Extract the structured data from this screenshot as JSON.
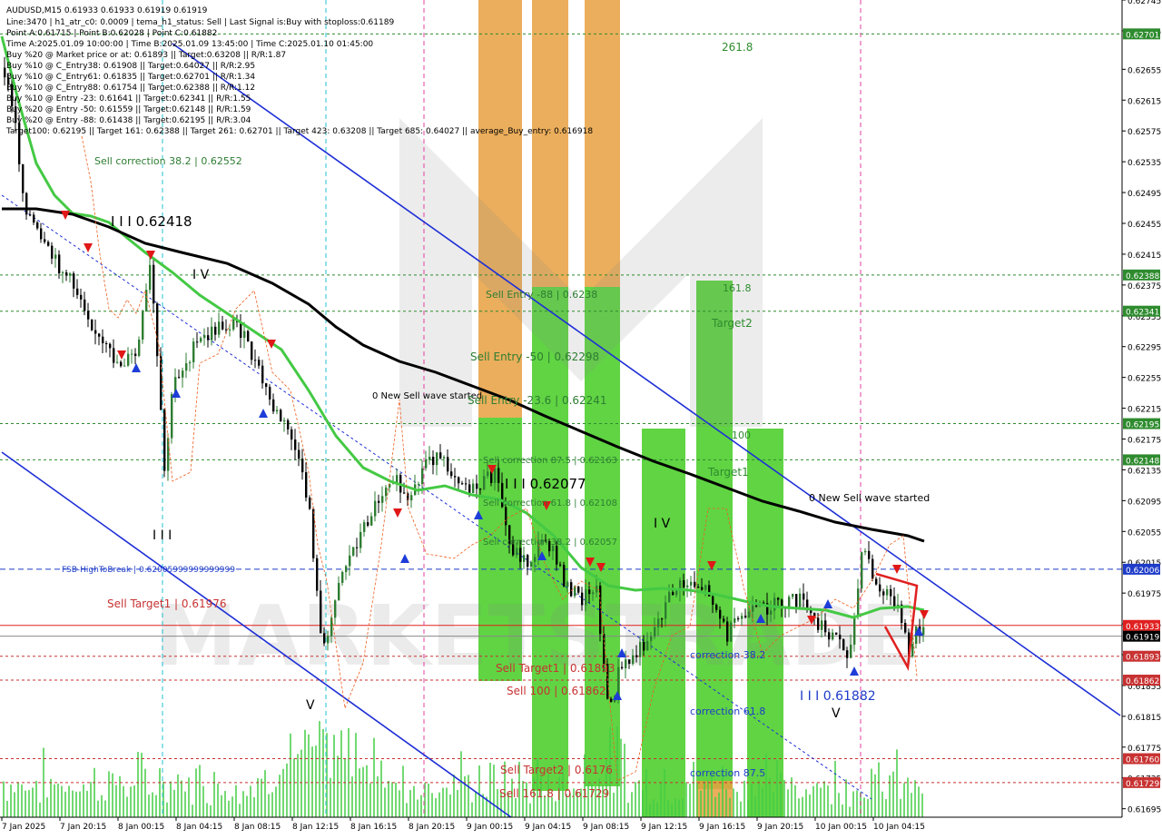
{
  "header": {
    "symbol_line": "AUDUSD,M15  0.61933 0.61933 0.61919 0.61919",
    "info_lines": [
      "Line:3470  |  h1_atr_c0: 0.0009  |  tema_h1_status: Sell  |  Last Signal is:Buy with stoploss:0.61189",
      "Point A:0.61715  |  Point B:0.62028  |  Point C:0.61882",
      "Time A:2025.01.09 10:00:00  |  Time B:2025.01.09 13:45:00  |  Time C:2025.01.10 01:45:00",
      "Buy %20 @ Market price or at: 0.61893  ||  Target:0.63208  ||  R/R:1.87",
      "Buy %10 @ C_Entry38: 0.61908  ||  Target:0.64027  ||  R/R:2.95",
      "Buy %10 @ C_Entry61: 0.61835  ||  Target:0.62701  ||  R/R:1.34",
      "Buy %10 @ C_Entry88: 0.61754  ||  Target:0.62388  ||  R/R:1.12",
      "Buy %10 @ Entry -23: 0.61641  ||  Target:0.62341  ||  R/R:1.55",
      "Buy %20 @ Entry -50: 0.61559  ||  Target:0.62148  ||  R/R:1.59",
      "Buy %20 @ Entry -88: 0.61438  ||  Target:0.62195  ||  R/R:3.04",
      "Target100: 0.62195  ||  Target 161: 0.62388  ||  Target 261: 0.62701  ||  Target 423: 0.63208  ||  Target 685: 0.64027  ||  average_Buy_entry: 0.616918"
    ]
  },
  "chart_data": {
    "type": "candlestick",
    "symbol": "AUDUSD",
    "timeframe": "M15",
    "ohlc_header": {
      "open": 0.61933,
      "high": 0.61933,
      "low": 0.61919,
      "close": 0.61919
    },
    "y_axis": {
      "range": [
        0.61684,
        0.62745
      ],
      "ticks": [
        "0.62745",
        "0.62705",
        "0.62655",
        "0.62615",
        "0.62575",
        "0.62535",
        "0.62495",
        "0.62455",
        "0.62415",
        "0.62375",
        "0.62335",
        "0.62295",
        "0.62255",
        "0.62215",
        "0.62175",
        "0.62135",
        "0.62095",
        "0.62055",
        "0.62015",
        "0.61975",
        "0.61935",
        "0.61895",
        "0.61855",
        "0.61815",
        "0.61775",
        "0.61735",
        "0.61695"
      ]
    },
    "x_axis": {
      "ticks": [
        "7 Jan 2025",
        "7 Jan 20:15",
        "8 Jan 00:15",
        "8 Jan 04:15",
        "8 Jan 08:15",
        "8 Jan 12:15",
        "8 Jan 16:15",
        "8 Jan 20:15",
        "9 Jan 00:15",
        "9 Jan 04:15",
        "9 Jan 08:15",
        "9 Jan 12:15",
        "9 Jan 16:15",
        "9 Jan 20:15",
        "10 Jan 00:15",
        "10 Jan 04:15"
      ]
    },
    "price_markers": [
      {
        "value": "0.62701",
        "color": "#2e8b2e"
      },
      {
        "value": "0.62388",
        "color": "#2e8b2e"
      },
      {
        "value": "0.62341",
        "color": "#2e8b2e"
      },
      {
        "value": "0.62195",
        "color": "#2e8b2e"
      },
      {
        "value": "0.62148",
        "color": "#2e8b2e"
      },
      {
        "value": "0.62006",
        "color": "#1e3cc8"
      },
      {
        "value": "0.61933",
        "color": "#e02020"
      },
      {
        "value": "0.61919",
        "color": "#000000"
      },
      {
        "value": "0.61893",
        "color": "#c83232"
      },
      {
        "value": "0.61862",
        "color": "#c83232"
      },
      {
        "value": "0.61760",
        "color": "#c83232"
      },
      {
        "value": "0.61729",
        "color": "#c83232"
      }
    ],
    "annotations": [
      {
        "text": "261.8",
        "color": "#2e8b2e"
      },
      {
        "text": "Sell correction 38.2 | 0.62552",
        "color": "#2e7d32"
      },
      {
        "text": "I I I  0.62418",
        "color": "#000000"
      },
      {
        "text": "I V",
        "color": "#000000"
      },
      {
        "text": "Sell Entry -88 | 0.6238",
        "color": "#2e7d32"
      },
      {
        "text": "161.8",
        "color": "#2e8b2e"
      },
      {
        "text": "Target2",
        "color": "#2e8b2e"
      },
      {
        "text": "Sell Entry -50 | 0.62298",
        "color": "#2e7d32"
      },
      {
        "text": "0 New Sell wave started",
        "color": "#000000"
      },
      {
        "text": "Sell Entry -23.6 | 0.62241",
        "color": "#2e7d32"
      },
      {
        "text": "100",
        "color": "#2e8b2e"
      },
      {
        "text": "Sell correction 87.5 | 0.62163",
        "color": "#2e7d32"
      },
      {
        "text": "Target1",
        "color": "#2e8b2e"
      },
      {
        "text": "I I I  0.62077",
        "color": "#000000"
      },
      {
        "text": "Sell correction 61.8 | 0.62108",
        "color": "#2e7d32"
      },
      {
        "text": "0 New Sell wave started",
        "color": "#000000"
      },
      {
        "text": "I I I",
        "color": "#000000"
      },
      {
        "text": "I V",
        "color": "#000000"
      },
      {
        "text": "Sell correction 38.2 | 0.62057",
        "color": "#2e7d32"
      },
      {
        "text": "FSB-HighToBreak | 0.62005999999999999",
        "color": "#1e3cc8"
      },
      {
        "text": "Sell Target1 | 0.61976",
        "color": "#c83232"
      },
      {
        "text": "correction 38.2",
        "color": "#1e3cc8"
      },
      {
        "text": "Sell Target1 | 0.61893",
        "color": "#c83232"
      },
      {
        "text": "Sell 100 | 0.61862",
        "color": "#c83232"
      },
      {
        "text": "I I I  0.61882",
        "color": "#1e3cc8"
      },
      {
        "text": "V",
        "color": "#000000"
      },
      {
        "text": "V",
        "color": "#000000"
      },
      {
        "text": "correction 61.8",
        "color": "#1e3cc8"
      },
      {
        "text": "Sell Target2 | 0.6176",
        "color": "#c83232"
      },
      {
        "text": "correction 87.5",
        "color": "#1e3cc8"
      },
      {
        "text": "Sell 161.8 | 0.61729",
        "color": "#c83232"
      }
    ],
    "watermark": "MARKETSTRADE",
    "colors": {
      "bull": "#2e7d32",
      "bear": "#000000",
      "ma_fast": "#44c944",
      "ma_slow": "#000000",
      "channel": "#1e2fd6",
      "zone_orange": "#e8a040",
      "zone_green": "#44cc22"
    }
  }
}
